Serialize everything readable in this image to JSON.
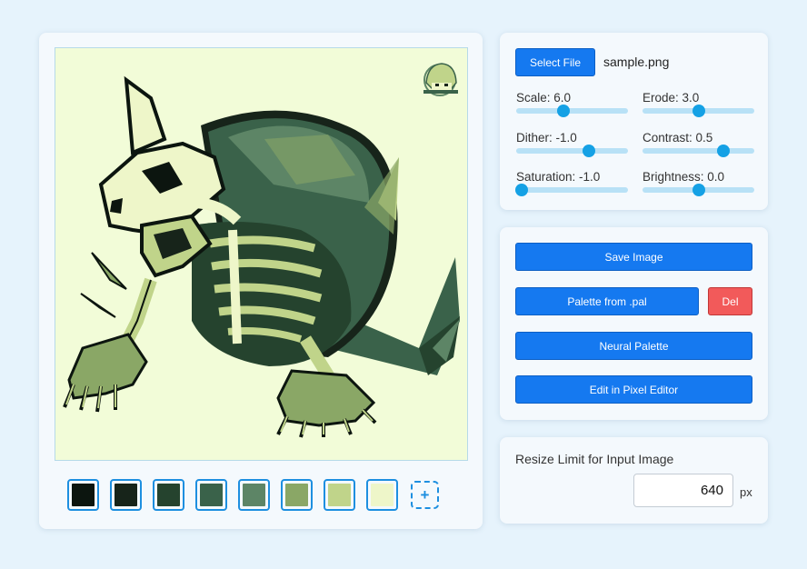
{
  "image": {
    "file_name": "sample.png",
    "subject": "pixel-art-skeletal-turtle-monster"
  },
  "controls": {
    "select_file_label": "Select File",
    "sliders": [
      {
        "id": "scale",
        "label": "Scale: 6.0",
        "level_pct": 42
      },
      {
        "id": "erode",
        "label": "Erode: 3.0",
        "level_pct": 50
      },
      {
        "id": "dither",
        "label": "Dither: -1.0",
        "level_pct": 65
      },
      {
        "id": "contrast",
        "label": "Contrast: 0.5",
        "level_pct": 72
      },
      {
        "id": "saturation",
        "label": "Saturation: -1.0",
        "level_pct": 5
      },
      {
        "id": "brightness",
        "label": "Brightness: 0.0",
        "level_pct": 50
      }
    ]
  },
  "actions": {
    "save_image": "Save Image",
    "palette_from_pal": "Palette from .pal",
    "delete": "Del",
    "neural_palette": "Neural Palette",
    "edit_in_pixel_editor": "Edit in Pixel Editor"
  },
  "resize": {
    "label": "Resize Limit for Input Image",
    "value": "640",
    "unit": "px"
  },
  "palette": {
    "colors": [
      "#0c150f",
      "#17241a",
      "#25432e",
      "#3a624a",
      "#5d8566",
      "#8aa766",
      "#c0d48a",
      "#eef6c9"
    ],
    "add_icon": "+"
  }
}
